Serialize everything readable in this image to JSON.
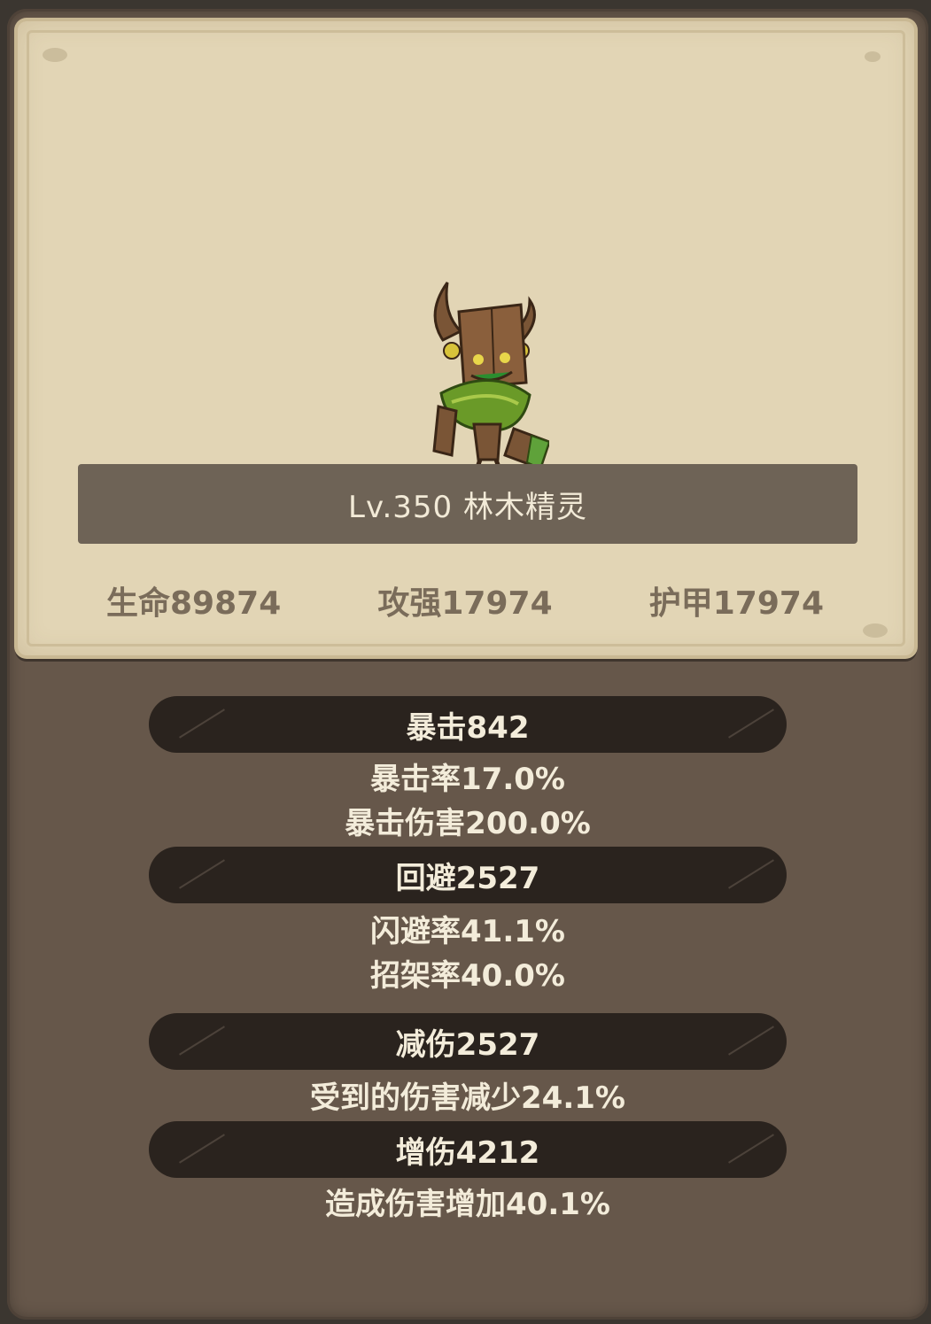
{
  "monster": {
    "name_label": "Lv.350 林木精灵",
    "image_icon": "wood-sprite-icon"
  },
  "base_stats": {
    "hp": "生命89874",
    "attack": "攻强17974",
    "armor": "护甲17974"
  },
  "sections": [
    {
      "title": "暴击842",
      "lines": [
        "暴击率17.0%",
        "暴击伤害200.0%"
      ]
    },
    {
      "title": "回避2527",
      "lines": [
        "闪避率41.1%",
        "招架率40.0%"
      ]
    },
    {
      "title": "减伤2527",
      "lines": [
        "受到的伤害减少24.1%"
      ]
    },
    {
      "title": "增伤4212",
      "lines": [
        "造成伤害增加40.1%"
      ]
    }
  ],
  "colors": {
    "panel_bg": "#66574a",
    "parchment": "#e2d5b5",
    "banner": "#6e6356",
    "pill": "#2a231e",
    "text_light": "#f3ecda",
    "text_stat": "#7a6c5a"
  }
}
